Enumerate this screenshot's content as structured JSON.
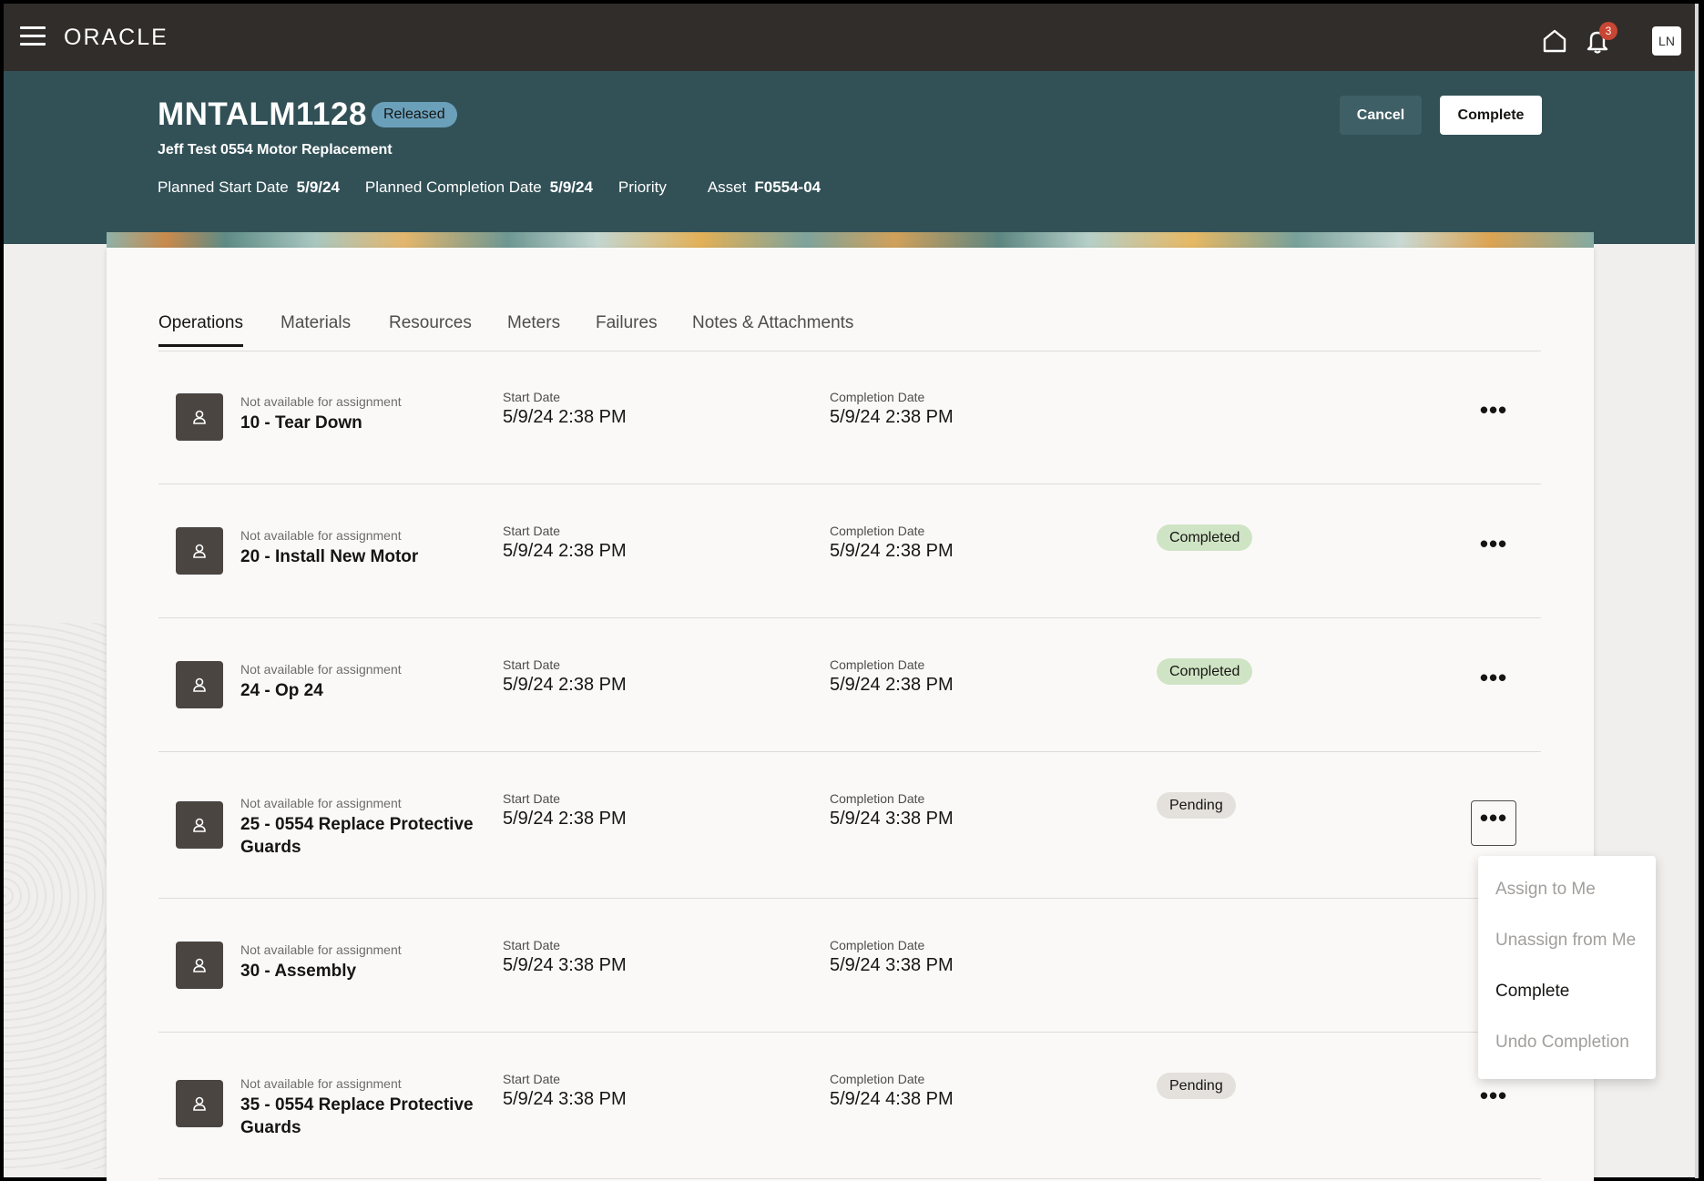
{
  "app": {
    "logo": "ORACLE",
    "notifications_count": "3",
    "user_initials": "LN"
  },
  "header": {
    "title": "MNTALM1128",
    "status": "Released",
    "subtitle": "Jeff Test 0554 Motor Replacement",
    "meta": [
      {
        "label": "Planned Start Date",
        "value": "5/9/24"
      },
      {
        "label": "Planned Completion Date",
        "value": "5/9/24"
      },
      {
        "label": "Priority",
        "value": ""
      },
      {
        "label": "Asset",
        "value": "F0554-04"
      }
    ],
    "cancel_label": "Cancel",
    "complete_label": "Complete"
  },
  "tabs": [
    "Operations",
    "Materials",
    "Resources",
    "Meters",
    "Failures",
    "Notes & Attachments"
  ],
  "columns": {
    "start": "Start Date",
    "completion": "Completion Date"
  },
  "operations": [
    {
      "sub": "Not available for assignment",
      "name": "10 - Tear Down",
      "start": "5/9/24 2:38 PM",
      "completion": "5/9/24 2:38 PM",
      "status": ""
    },
    {
      "sub": "Not available for assignment",
      "name": "20 - Install New Motor",
      "start": "5/9/24 2:38 PM",
      "completion": "5/9/24 2:38 PM",
      "status": "Completed"
    },
    {
      "sub": "Not available for assignment",
      "name": "24 - Op 24",
      "start": "5/9/24 2:38 PM",
      "completion": "5/9/24 2:38 PM",
      "status": "Completed"
    },
    {
      "sub": "Not available for assignment",
      "name": "25 - 0554 Replace Protective Guards",
      "start": "5/9/24 2:38 PM",
      "completion": "5/9/24 3:38 PM",
      "status": "Pending"
    },
    {
      "sub": "Not available for assignment",
      "name": "30 - Assembly",
      "start": "5/9/24 3:38 PM",
      "completion": "5/9/24 3:38 PM",
      "status": ""
    },
    {
      "sub": "Not available for assignment",
      "name": "35 - 0554 Replace Protective Guards",
      "start": "5/9/24 3:38 PM",
      "completion": "5/9/24 4:38 PM",
      "status": "Pending"
    }
  ],
  "more_glyph": "•••",
  "menu": [
    {
      "label": "Assign to Me",
      "enabled": false
    },
    {
      "label": "Unassign from Me",
      "enabled": false
    },
    {
      "label": "Complete",
      "enabled": true
    },
    {
      "label": "Undo Completion",
      "enabled": false
    }
  ],
  "colors": {
    "topbar": "#312d2a",
    "header": "#325157",
    "badge": "#6ba0ba",
    "completed": "#cfe4c4",
    "pending": "#e4e1dd",
    "notification": "#c74634"
  }
}
